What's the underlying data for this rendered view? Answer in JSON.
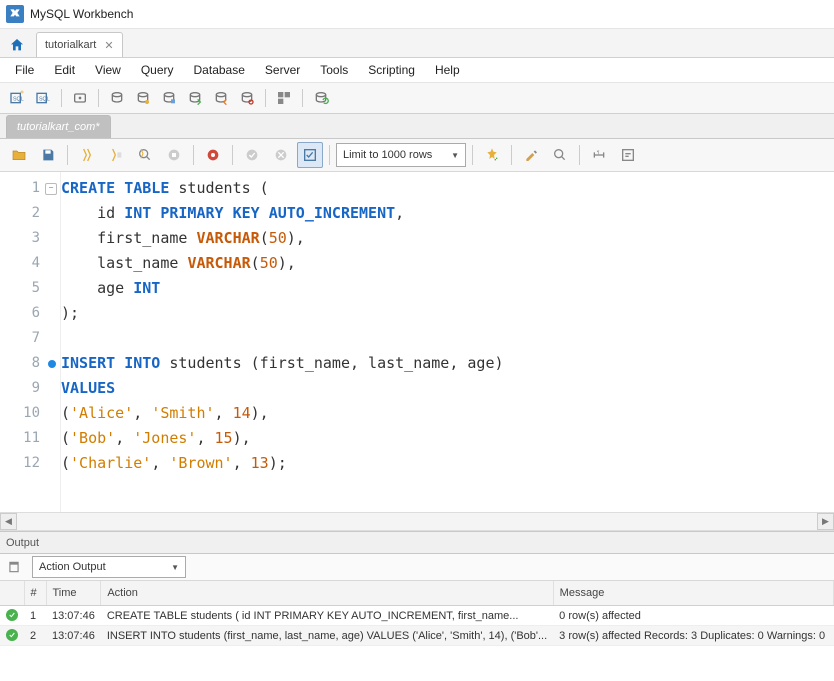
{
  "app": {
    "title": "MySQL Workbench"
  },
  "connection_tab": {
    "label": "tutorialkart"
  },
  "menu": [
    "File",
    "Edit",
    "View",
    "Query",
    "Database",
    "Server",
    "Tools",
    "Scripting",
    "Help"
  ],
  "query_tab": {
    "label": "tutorialkart_com*"
  },
  "limit": {
    "label": "Limit to 1000 rows"
  },
  "code": {
    "lines": [
      {
        "n": 1,
        "fold": true,
        "tokens": [
          [
            "kw",
            "CREATE"
          ],
          [
            "pl",
            " "
          ],
          [
            "kw",
            "TABLE"
          ],
          [
            "pl",
            " students ("
          ]
        ]
      },
      {
        "n": 2,
        "tokens": [
          [
            "pl",
            "    id "
          ],
          [
            "kw",
            "INT"
          ],
          [
            "pl",
            " "
          ],
          [
            "kw",
            "PRIMARY"
          ],
          [
            "pl",
            " "
          ],
          [
            "kw",
            "KEY"
          ],
          [
            "pl",
            " "
          ],
          [
            "kw",
            "AUTO_INCREMENT"
          ],
          [
            "pl",
            ","
          ]
        ]
      },
      {
        "n": 3,
        "tokens": [
          [
            "pl",
            "    first_name "
          ],
          [
            "ty",
            "VARCHAR"
          ],
          [
            "pl",
            "("
          ],
          [
            "num",
            "50"
          ],
          [
            "pl",
            "),"
          ]
        ]
      },
      {
        "n": 4,
        "tokens": [
          [
            "pl",
            "    last_name "
          ],
          [
            "ty",
            "VARCHAR"
          ],
          [
            "pl",
            "("
          ],
          [
            "num",
            "50"
          ],
          [
            "pl",
            "),"
          ]
        ]
      },
      {
        "n": 5,
        "tokens": [
          [
            "pl",
            "    age "
          ],
          [
            "kw",
            "INT"
          ]
        ]
      },
      {
        "n": 6,
        "tokens": [
          [
            "pl",
            ");"
          ]
        ]
      },
      {
        "n": 7,
        "tokens": [
          [
            "pl",
            ""
          ]
        ]
      },
      {
        "n": 8,
        "mark": "#1e88e5",
        "tokens": [
          [
            "kw",
            "INSERT"
          ],
          [
            "pl",
            " "
          ],
          [
            "kw",
            "INTO"
          ],
          [
            "pl",
            " students (first_name, last_name, age)"
          ]
        ]
      },
      {
        "n": 9,
        "tokens": [
          [
            "kw",
            "VALUES"
          ]
        ]
      },
      {
        "n": 10,
        "tokens": [
          [
            "pl",
            "("
          ],
          [
            "str",
            "'Alice'"
          ],
          [
            "pl",
            ", "
          ],
          [
            "str",
            "'Smith'"
          ],
          [
            "pl",
            ", "
          ],
          [
            "num",
            "14"
          ],
          [
            "pl",
            "),"
          ]
        ]
      },
      {
        "n": 11,
        "tokens": [
          [
            "pl",
            "("
          ],
          [
            "str",
            "'Bob'"
          ],
          [
            "pl",
            ", "
          ],
          [
            "str",
            "'Jones'"
          ],
          [
            "pl",
            ", "
          ],
          [
            "num",
            "15"
          ],
          [
            "pl",
            "),"
          ]
        ]
      },
      {
        "n": 12,
        "tokens": [
          [
            "pl",
            "("
          ],
          [
            "str",
            "'Charlie'"
          ],
          [
            "pl",
            ", "
          ],
          [
            "str",
            "'Brown'"
          ],
          [
            "pl",
            ", "
          ],
          [
            "num",
            "13"
          ],
          [
            "pl",
            ");"
          ]
        ]
      }
    ]
  },
  "output": {
    "panel_label": "Output",
    "selector": "Action Output",
    "headers": {
      "num": "#",
      "time": "Time",
      "action": "Action",
      "message": "Message"
    },
    "rows": [
      {
        "status": "ok",
        "n": "1",
        "time": "13:07:46",
        "action": "CREATE TABLE students (     id INT PRIMARY KEY AUTO_INCREMENT,     first_name...",
        "message": "0 row(s) affected"
      },
      {
        "status": "ok",
        "n": "2",
        "time": "13:07:46",
        "action": "INSERT INTO students (first_name, last_name, age) VALUES  ('Alice', 'Smith', 14), ('Bob'...",
        "message": "3 row(s) affected Records: 3  Duplicates: 0  Warnings: 0"
      }
    ]
  }
}
